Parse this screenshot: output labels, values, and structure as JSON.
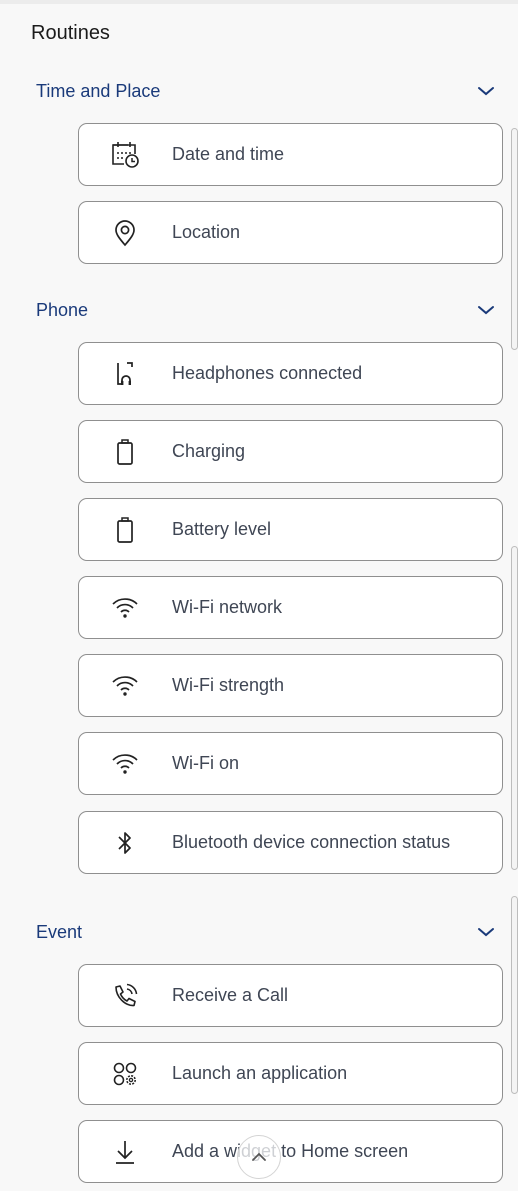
{
  "page": {
    "title": "Routines"
  },
  "sections": [
    {
      "label": "Time and Place",
      "expand_icon": "chevron-down-icon",
      "items": [
        {
          "label": "Date and time",
          "icon": "calendar-clock-icon"
        },
        {
          "label": "Location",
          "icon": "location-pin-icon"
        }
      ]
    },
    {
      "label": "Phone",
      "expand_icon": "chevron-down-icon",
      "items": [
        {
          "label": "Headphones connected",
          "icon": "headphones-icon"
        },
        {
          "label": "Charging",
          "icon": "battery-icon"
        },
        {
          "label": "Battery level",
          "icon": "battery-icon"
        },
        {
          "label": "Wi-Fi network",
          "icon": "wifi-icon"
        },
        {
          "label": "Wi-Fi strength",
          "icon": "wifi-icon"
        },
        {
          "label": "Wi-Fi on",
          "icon": "wifi-icon"
        },
        {
          "label": "Bluetooth device connection status",
          "icon": "bluetooth-icon"
        }
      ]
    },
    {
      "label": "Event",
      "expand_icon": "chevron-down-icon",
      "items": [
        {
          "label": "Receive a Call",
          "icon": "phone-ringing-icon"
        },
        {
          "label": "Launch an application",
          "icon": "apps-settings-icon"
        },
        {
          "label": "Add a widget to Home screen",
          "icon": "download-arrow-icon"
        }
      ]
    }
  ],
  "scroll_top_button": {
    "icon": "chevron-up-icon"
  },
  "colors": {
    "section_heading": "#1a3a7a",
    "item_text": "#3f4654",
    "card_border": "#8f8f8f",
    "background": "#f8f8f8"
  }
}
